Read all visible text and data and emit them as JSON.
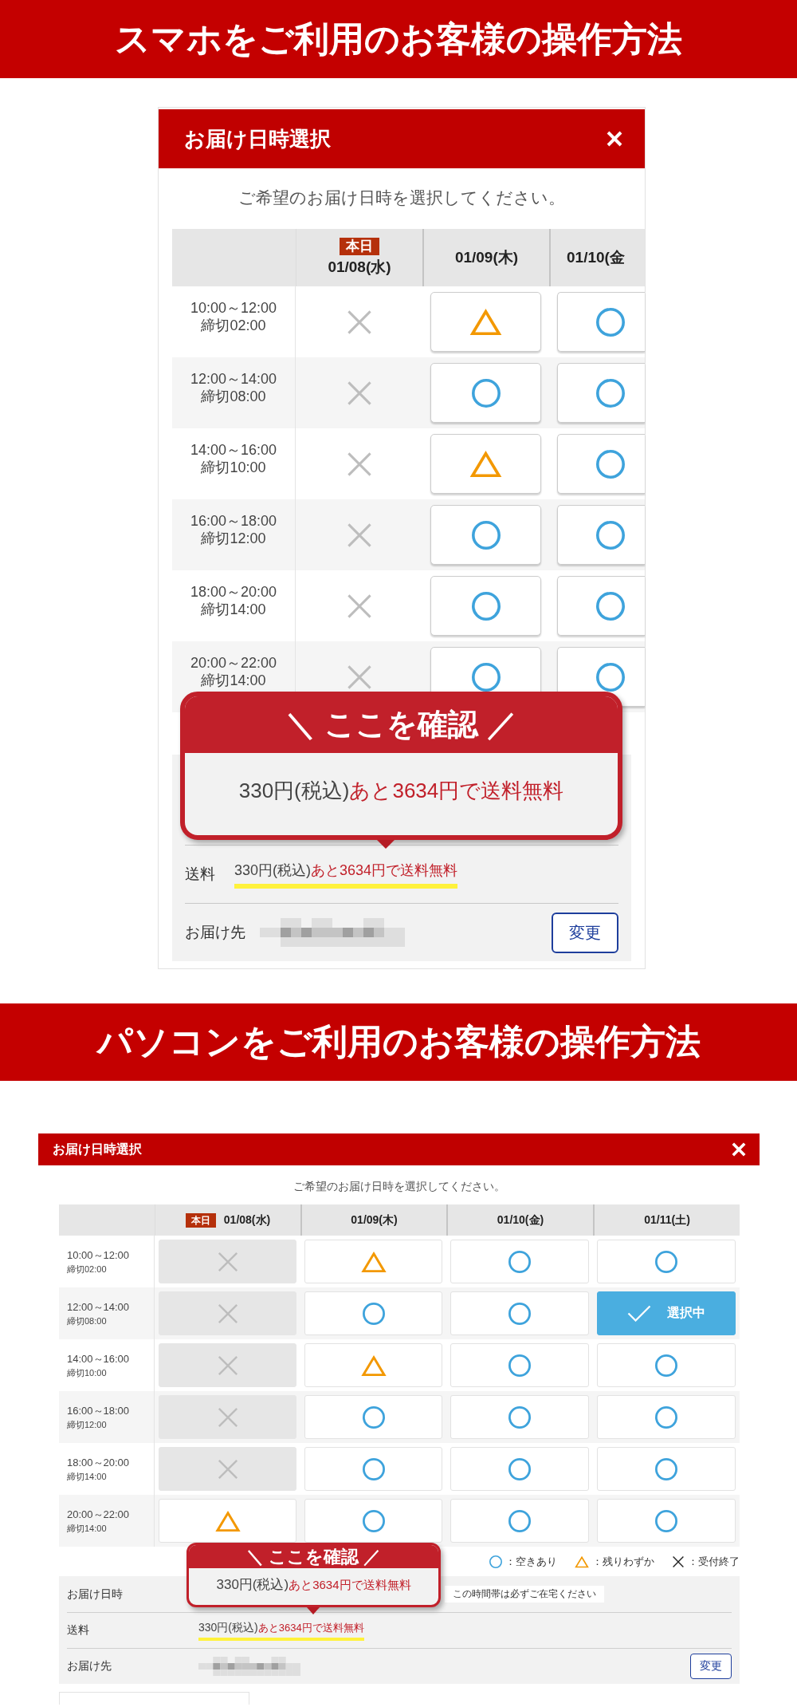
{
  "sections": [
    {
      "kind": "mobile",
      "banner": "スマホをご利用のお客様の操作方法",
      "dialog": {
        "title": "お届け日時選択",
        "subtitle": "ご希望のお届け日時を選択してください。",
        "columns": [
          {
            "date": "01/08(水)",
            "badge": "本日"
          },
          {
            "date": "01/09(木)"
          },
          {
            "date": "01/10(金"
          }
        ],
        "rows": [
          {
            "time": "10:00～12:00",
            "deadline": "締切02:00",
            "slots": [
              {
                "kind": "closed",
                "selected": false
              },
              {
                "kind": "few",
                "selected": false
              },
              {
                "kind": "available",
                "selected": false
              }
            ]
          },
          {
            "time": "12:00～14:00",
            "deadline": "締切08:00",
            "slots": [
              {
                "kind": "closed",
                "selected": false
              },
              {
                "kind": "available",
                "selected": false
              },
              {
                "kind": "available",
                "selected": false
              }
            ]
          },
          {
            "time": "14:00～16:00",
            "deadline": "締切10:00",
            "slots": [
              {
                "kind": "closed",
                "selected": false
              },
              {
                "kind": "few",
                "selected": false
              },
              {
                "kind": "available",
                "selected": false
              }
            ]
          },
          {
            "time": "16:00～18:00",
            "deadline": "締切12:00",
            "slots": [
              {
                "kind": "closed",
                "selected": false
              },
              {
                "kind": "available",
                "selected": false
              },
              {
                "kind": "available",
                "selected": false
              }
            ]
          },
          {
            "time": "18:00～20:00",
            "deadline": "締切14:00",
            "slots": [
              {
                "kind": "closed",
                "selected": false
              },
              {
                "kind": "available",
                "selected": false
              },
              {
                "kind": "available",
                "selected": false
              }
            ]
          },
          {
            "time": "20:00～22:00",
            "deadline": "締切14:00",
            "slots": [
              {
                "kind": "closed",
                "selected": false
              },
              {
                "kind": "available",
                "selected": false
              },
              {
                "kind": "available",
                "selected": false
              }
            ]
          }
        ],
        "callout": {
          "title": "＼ ここを確認 ／",
          "price": "330円(税込)",
          "note": "あと3634円で送料無料"
        },
        "details": [
          {
            "kind": "shipping",
            "label": "送料",
            "price": "330円(税込)",
            "note": "あと3634円で送料無料",
            "highlighted": true
          },
          {
            "kind": "address",
            "label": "お届け先",
            "button": "変更"
          }
        ]
      }
    },
    {
      "kind": "desktop",
      "banner": "パソコンをご利用のお客様の操作方法",
      "dialog": {
        "title": "お届け日時選択",
        "subtitle": "ご希望のお届け日時を選択してください。",
        "columns": [
          {
            "date": "01/08(水)",
            "badge": "本日"
          },
          {
            "date": "01/09(木)"
          },
          {
            "date": "01/10(金)"
          },
          {
            "date": "01/11(土)"
          }
        ],
        "rows": [
          {
            "time": "10:00～12:00",
            "deadline": "締切02:00",
            "slots": [
              {
                "kind": "closed",
                "selected": false
              },
              {
                "kind": "few",
                "selected": false
              },
              {
                "kind": "available",
                "selected": false
              },
              {
                "kind": "available",
                "selected": false
              }
            ]
          },
          {
            "time": "12:00～14:00",
            "deadline": "締切08:00",
            "slots": [
              {
                "kind": "closed",
                "selected": false
              },
              {
                "kind": "available",
                "selected": false
              },
              {
                "kind": "available",
                "selected": false
              },
              {
                "selected": true,
                "label": "選択中"
              }
            ]
          },
          {
            "time": "14:00～16:00",
            "deadline": "締切10:00",
            "slots": [
              {
                "kind": "closed",
                "selected": false
              },
              {
                "kind": "few",
                "selected": false
              },
              {
                "kind": "available",
                "selected": false
              },
              {
                "kind": "available",
                "selected": false
              }
            ]
          },
          {
            "time": "16:00～18:00",
            "deadline": "締切12:00",
            "slots": [
              {
                "kind": "closed",
                "selected": false
              },
              {
                "kind": "available",
                "selected": false
              },
              {
                "kind": "available",
                "selected": false
              },
              {
                "kind": "available",
                "selected": false
              }
            ]
          },
          {
            "time": "18:00～20:00",
            "deadline": "締切14:00",
            "slots": [
              {
                "kind": "closed",
                "selected": false
              },
              {
                "kind": "available",
                "selected": false
              },
              {
                "kind": "available",
                "selected": false
              },
              {
                "kind": "available",
                "selected": false
              }
            ]
          },
          {
            "time": "20:00～22:00",
            "deadline": "締切14:00",
            "slots": [
              {
                "kind": "few",
                "selected": false
              },
              {
                "kind": "available",
                "selected": false
              },
              {
                "kind": "available",
                "selected": false
              },
              {
                "kind": "available",
                "selected": false
              }
            ]
          }
        ],
        "legend": [
          {
            "kind": "available",
            "label": "：空きあり"
          },
          {
            "kind": "few",
            "label": "：残りわずか"
          },
          {
            "kind": "closed",
            "label": "：受付終了"
          }
        ],
        "callout": {
          "title": "＼ ここを確認 ／",
          "price": "330円(税込)",
          "note": "あと3634円で送料無料"
        },
        "details": [
          {
            "kind": "date",
            "label": "お届け日時",
            "notice": "この時間帯は必ずご在宅ください"
          },
          {
            "kind": "shipping",
            "label": "送料",
            "price": "330円(税込)",
            "note": "あと3634円で送料無料",
            "highlighted": true
          },
          {
            "kind": "address",
            "label": "お届け先",
            "button": "変更"
          }
        ]
      }
    }
  ]
}
